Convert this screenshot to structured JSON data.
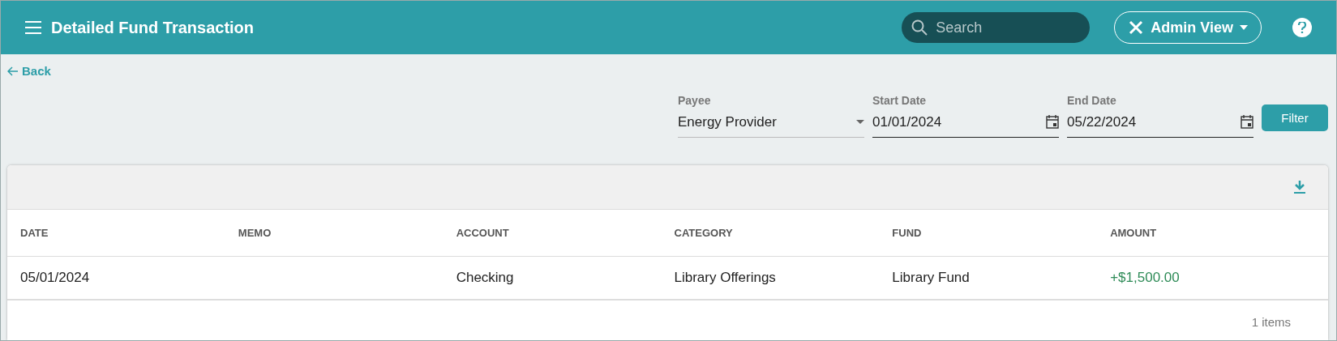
{
  "header": {
    "title": "Detailed Fund Transaction",
    "search": {
      "placeholder": "Search"
    },
    "view_button": "Admin View"
  },
  "back_link": "Back",
  "filters": {
    "payee": {
      "label": "Payee",
      "value": "Energy Provider"
    },
    "start_date": {
      "label": "Start Date",
      "value": "01/01/2024"
    },
    "end_date": {
      "label": "End Date",
      "value": "05/22/2024"
    },
    "button": "Filter"
  },
  "table": {
    "columns": [
      "DATE",
      "MEMO",
      "ACCOUNT",
      "CATEGORY",
      "FUND",
      "AMOUNT"
    ],
    "rows": [
      [
        "05/01/2024",
        "",
        "Checking",
        "Library Offerings",
        "Library Fund",
        "+$1,500.00"
      ]
    ],
    "footer": "1 items"
  }
}
